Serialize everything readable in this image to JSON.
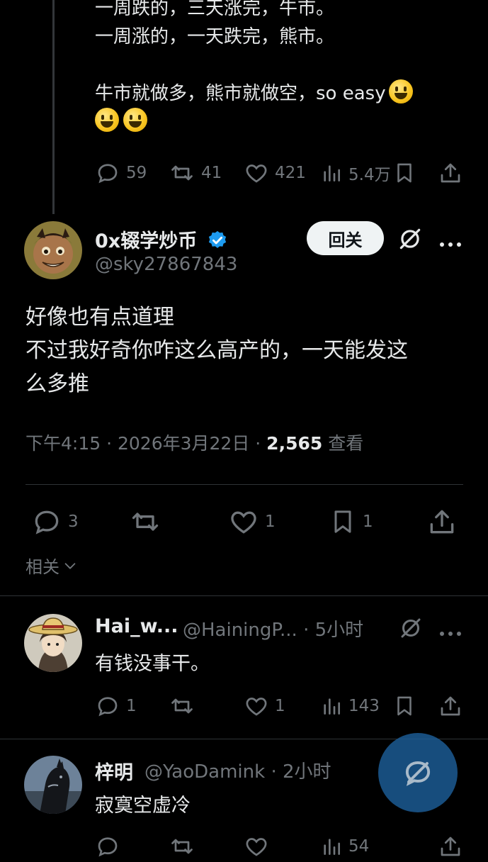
{
  "prev_tweet": {
    "lines": [
      "一周跌的，三天涨完，牛市。",
      "一周涨的，一天跌完，熊市。",
      "",
      "牛市就做多，熊市就做空，so easy"
    ],
    "stats": {
      "replies": "59",
      "retweets": "41",
      "likes": "421",
      "views": "5.4万"
    }
  },
  "main_tweet": {
    "display_name": "0x辍学炒币",
    "handle": "@sky27867843",
    "follow_label": "回关",
    "text_lines": [
      "好像也有点道理",
      "不过我好奇你咋这么高产的，一天能发这",
      "么多推"
    ],
    "time": "下午4:15 · 2026年3月22日 · ",
    "views": "2,565",
    "views_label": " 查看",
    "stats": {
      "replies": "3",
      "likes": "1",
      "bookmarks": "1"
    },
    "related_label": "相关"
  },
  "replies": [
    {
      "display_name": "Hai_w...",
      "handle_time": "@HainingP... · 5小时",
      "text": "有钱没事干。",
      "stats": {
        "replies": "1",
        "likes": "1",
        "views": "143"
      }
    },
    {
      "display_name": "梓明",
      "handle_time": "@YaoDamink · 2小时",
      "text": "寂寞空虚冷",
      "stats": {
        "views": "54"
      }
    }
  ],
  "colors": {
    "background": "#000000",
    "text": "#e7e9ea",
    "muted": "#71767b",
    "verified": "#1d9bf0",
    "fab": "#1d5e99"
  }
}
